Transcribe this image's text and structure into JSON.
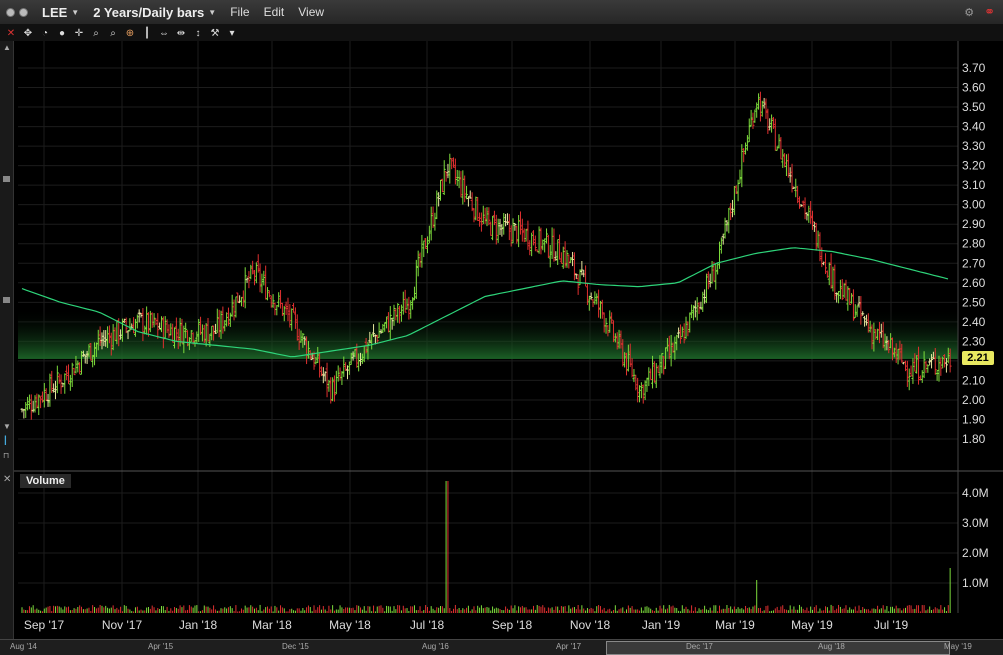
{
  "titlebar": {
    "symbol": "LEE",
    "period": "2 Years/Daily bars",
    "menus": [
      "File",
      "Edit",
      "View"
    ]
  },
  "colors": {
    "background": "#000000",
    "up_bar": "#7ddc3c",
    "down_bar": "#e03030",
    "neutral_bar": "#e8e8a0",
    "moving_average": "#2ed47a",
    "price_tag": "#e8e860"
  },
  "volume_panel": {
    "label": "Volume",
    "axis_labels": [
      "4.0M",
      "3.0M",
      "2.0M",
      "1.0M"
    ]
  },
  "price_axis": {
    "labels": [
      "3.70",
      "3.60",
      "3.50",
      "3.40",
      "3.30",
      "3.20",
      "3.10",
      "3.00",
      "2.90",
      "2.80",
      "2.70",
      "2.60",
      "2.50",
      "2.40",
      "2.30",
      "2.20",
      "2.10",
      "2.00",
      "1.90",
      "1.80"
    ]
  },
  "current_price": "2.21",
  "time_axis": {
    "labels": [
      "Sep '17",
      "Nov '17",
      "Jan '18",
      "Mar '18",
      "May '18",
      "Jul '18",
      "Sep '18",
      "Nov '18",
      "Jan '19",
      "Mar '19",
      "May '19",
      "Jul '19"
    ]
  },
  "navigator": {
    "labels": [
      "Aug '14",
      "Apr '15",
      "Dec '15",
      "Aug '16",
      "Apr '17",
      "Dec '17",
      "Aug '18",
      "May '19"
    ]
  },
  "chart_data": {
    "type": "candlestick",
    "ylim": [
      1.75,
      3.75
    ],
    "x": [
      "Aug '17",
      "Sep '17",
      "Oct '17",
      "Nov '17",
      "Dec '17",
      "Jan '18",
      "Feb '18",
      "Mar '18",
      "Apr '18",
      "May '18",
      "Jun '18",
      "Jul '18",
      "Aug '18",
      "Sep '18",
      "Oct '18",
      "Nov '18",
      "Dec '18",
      "Jan '19",
      "Feb '19",
      "Mar '19",
      "Apr '19",
      "May '19",
      "Jun '19",
      "Jul '19",
      "Aug '19"
    ],
    "close_approx": [
      1.95,
      2.1,
      2.3,
      2.4,
      2.35,
      2.35,
      2.65,
      2.4,
      2.05,
      2.3,
      2.5,
      3.2,
      2.9,
      2.85,
      2.75,
      2.45,
      2.05,
      2.3,
      2.7,
      3.55,
      3.1,
      2.6,
      2.35,
      2.15,
      2.21
    ],
    "moving_average_approx": [
      2.57,
      2.5,
      2.45,
      2.35,
      2.3,
      2.28,
      2.26,
      2.22,
      2.25,
      2.28,
      2.33,
      2.43,
      2.53,
      2.57,
      2.61,
      2.59,
      2.58,
      2.6,
      2.7,
      2.75,
      2.78,
      2.76,
      2.72,
      2.67,
      2.62
    ],
    "volume_approx_millions": [
      0.2,
      0.1,
      0.2,
      0.15,
      0.2,
      0.2,
      0.3,
      0.2,
      0.2,
      0.2,
      0.25,
      4.4,
      0.3,
      0.2,
      0.2,
      0.2,
      0.3,
      0.3,
      0.3,
      1.1,
      0.2,
      0.3,
      0.3,
      0.6,
      1.5
    ]
  }
}
